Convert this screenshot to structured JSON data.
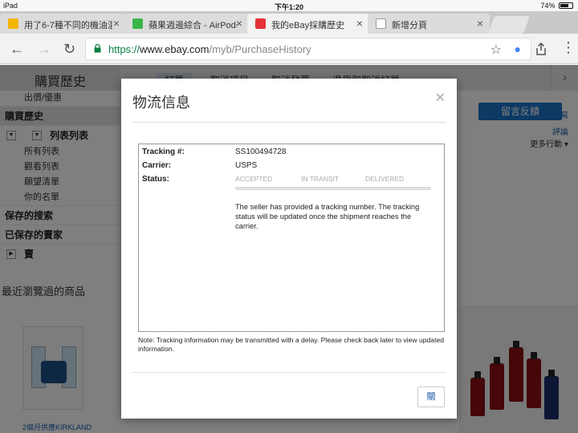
{
  "status_bar": {
    "device": "iPad",
    "time": "下午1:20",
    "battery": "74%",
    "battery_level": 0.74
  },
  "tabs": [
    {
      "title": "用了6-7種不同的機油混",
      "favicon_color": "#f4b400"
    },
    {
      "title": "蘋果週邊綜合 - AirPods",
      "favicon_color": "#3bb54a"
    },
    {
      "title": "我的eBay採購歷史",
      "favicon_color": "#e53238"
    },
    {
      "title": "新增分頁",
      "favicon_color": "#9e9e9e"
    }
  ],
  "address_bar": {
    "scheme": "https://",
    "host": "www.ebay.com",
    "path": "/myb/PurchaseHistory"
  },
  "page": {
    "title": "購買歷史",
    "nav_tabs": [
      "訂單",
      "取消項目",
      "取消發票",
      "退貨和取消訂單"
    ],
    "sidebar": {
      "offers": "出價/優惠",
      "purchase_history": "購買歷史",
      "lists_header": "列表列表",
      "list_items": [
        "所有列表",
        "觀看列表",
        "願望清單",
        "你的名單"
      ],
      "saved_searches": "保存的搜索",
      "saved_sellers": "已保存的賣家",
      "sell": "賣"
    },
    "recently_viewed": "最近瀏覽過的商品",
    "recent_item_caption": "2個月供應KIRKLAND",
    "feedback_button": "留言反饋",
    "right_links": [
      "寫",
      "評論",
      "更多行動"
    ]
  },
  "modal": {
    "title": "物流信息",
    "tracking_label": "Tracking #:",
    "tracking_number": "SS100494728",
    "carrier_label": "Carrier:",
    "carrier": "USPS",
    "status_label": "Status:",
    "steps": [
      "ACCEPTED",
      "IN TRANSIT",
      "DELIVERED"
    ],
    "progress_fraction": 0,
    "message": "The seller has provided a tracking number. The tracking status will be updated once the shipment reaches the carrier.",
    "note": "Note: Tracking information may be transmitted with a delay. Please check back later to view updated information.",
    "close_label": "關"
  },
  "colors": {
    "accent": "#1a73c7",
    "secure_green": "#0b8043",
    "progress_fill": "#9bd3ff"
  }
}
